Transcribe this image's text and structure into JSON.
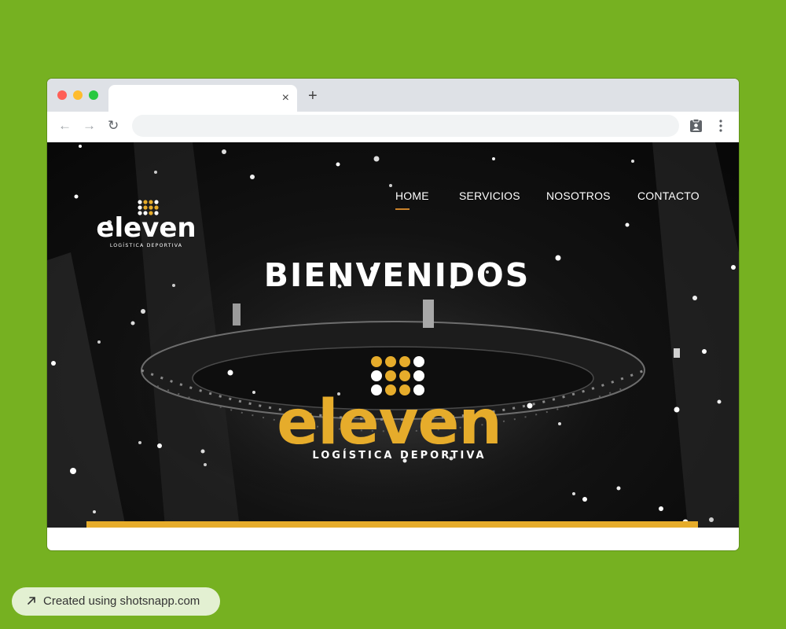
{
  "browser": {
    "tab_close": "×",
    "new_tab": "+",
    "url": ""
  },
  "site": {
    "logo_text": "eleven",
    "logo_tagline": "LOGÍSTICA DEPORTIVA",
    "nav": [
      "HOME",
      "SERVICIOS",
      "NOSOTROS",
      "CONTACTO"
    ],
    "active_nav": "HOME",
    "hero_title": "BIENVENIDOS",
    "hero_logo_text": "eleven",
    "hero_tagline": "LOGÍSTICA DEPORTIVA"
  },
  "badge": {
    "text": "Created using shotsnapp.com"
  },
  "colors": {
    "page_background": "#76b121",
    "brand_gold": "#e6ac2b",
    "hero_background": "#0b0b0b",
    "nav_active_underline": "#c9822a"
  },
  "icons": {
    "back": "arrow-left-icon",
    "forward": "arrow-right-icon",
    "reload": "reload-icon",
    "profile": "profile-clipboard-icon",
    "menu": "vertical-dots-icon",
    "badge": "arrow-up-right-icon"
  }
}
